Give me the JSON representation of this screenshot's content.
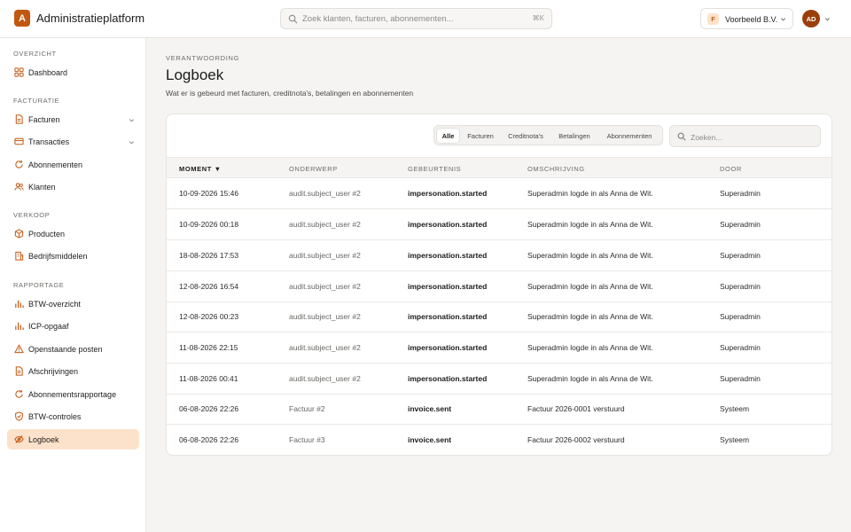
{
  "app": {
    "logo_letter": "A",
    "title": "Administratieplatform"
  },
  "search": {
    "placeholder": "Zoek klanten, facturen, abonnementen...",
    "shortcut": "⌘K"
  },
  "org": {
    "badge": "F",
    "name": "Voorbeeld B.V."
  },
  "user": {
    "initials": "AD"
  },
  "sidebar": {
    "sections": [
      {
        "title": "OVERZICHT",
        "items": [
          {
            "label": "Dashboard",
            "icon": "grid-icon"
          }
        ]
      },
      {
        "title": "FACTURATIE",
        "items": [
          {
            "label": "Facturen",
            "icon": "document-icon",
            "expandable": true
          },
          {
            "label": "Transacties",
            "icon": "card-icon",
            "expandable": true
          },
          {
            "label": "Abonnementen",
            "icon": "refresh-icon"
          },
          {
            "label": "Klanten",
            "icon": "users-icon"
          }
        ]
      },
      {
        "title": "VERKOOP",
        "items": [
          {
            "label": "Producten",
            "icon": "box-icon"
          },
          {
            "label": "Bedrijfsmiddelen",
            "icon": "building-icon"
          }
        ]
      },
      {
        "title": "RAPPORTAGE",
        "items": [
          {
            "label": "BTW-overzicht",
            "icon": "bar-chart-icon"
          },
          {
            "label": "ICP-opgaaf",
            "icon": "bar-chart-icon"
          },
          {
            "label": "Openstaande posten",
            "icon": "warning-icon"
          },
          {
            "label": "Afschrijvingen",
            "icon": "document-icon"
          },
          {
            "label": "Abonnementsrapportage",
            "icon": "refresh-icon"
          },
          {
            "label": "BTW-controles",
            "icon": "shield-icon"
          },
          {
            "label": "Logboek",
            "icon": "eye-off-icon",
            "active": true
          }
        ]
      }
    ]
  },
  "page": {
    "eyebrow": "VERANTWOORDING",
    "title": "Logboek",
    "subtitle": "Wat er is gebeurd met facturen, creditnota's, betalingen en abonnementen"
  },
  "filters": {
    "options": [
      "Alle",
      "Facturen",
      "Creditnota's",
      "Betalingen",
      "Abonnementen"
    ],
    "selected": "Alle"
  },
  "table_search": {
    "placeholder": "Zoeken..."
  },
  "table": {
    "columns": [
      "MOMENT",
      "ONDERWERP",
      "GEBEURTENIS",
      "OMSCHRIJVING",
      "DOOR"
    ],
    "sort_indicator": "▼",
    "rows": [
      [
        "10-09-2026 15:46",
        "audit.subject_user #2",
        "impersonation.started",
        "Superadmin logde in als Anna de Wit.",
        "Superadmin"
      ],
      [
        "10-09-2026 00:18",
        "audit.subject_user #2",
        "impersonation.started",
        "Superadmin logde in als Anna de Wit.",
        "Superadmin"
      ],
      [
        "18-08-2026 17:53",
        "audit.subject_user #2",
        "impersonation.started",
        "Superadmin logde in als Anna de Wit.",
        "Superadmin"
      ],
      [
        "12-08-2026 16:54",
        "audit.subject_user #2",
        "impersonation.started",
        "Superadmin logde in als Anna de Wit.",
        "Superadmin"
      ],
      [
        "12-08-2026 00:23",
        "audit.subject_user #2",
        "impersonation.started",
        "Superadmin logde in als Anna de Wit.",
        "Superadmin"
      ],
      [
        "11-08-2026 22:15",
        "audit.subject_user #2",
        "impersonation.started",
        "Superadmin logde in als Anna de Wit.",
        "Superadmin"
      ],
      [
        "11-08-2026 00:41",
        "audit.subject_user #2",
        "impersonation.started",
        "Superadmin logde in als Anna de Wit.",
        "Superadmin"
      ],
      [
        "06-08-2026 22:26",
        "Factuur #2",
        "invoice.sent",
        "Factuur 2026-0001 verstuurd",
        "Systeem"
      ],
      [
        "06-08-2026 22:26",
        "Factuur #3",
        "invoice.sent",
        "Factuur 2026-0002 verstuurd",
        "Systeem"
      ]
    ]
  },
  "colors": {
    "accent": "#c2570f",
    "active_bg": "#fde2cb",
    "avatar": "#9a3f0c"
  }
}
